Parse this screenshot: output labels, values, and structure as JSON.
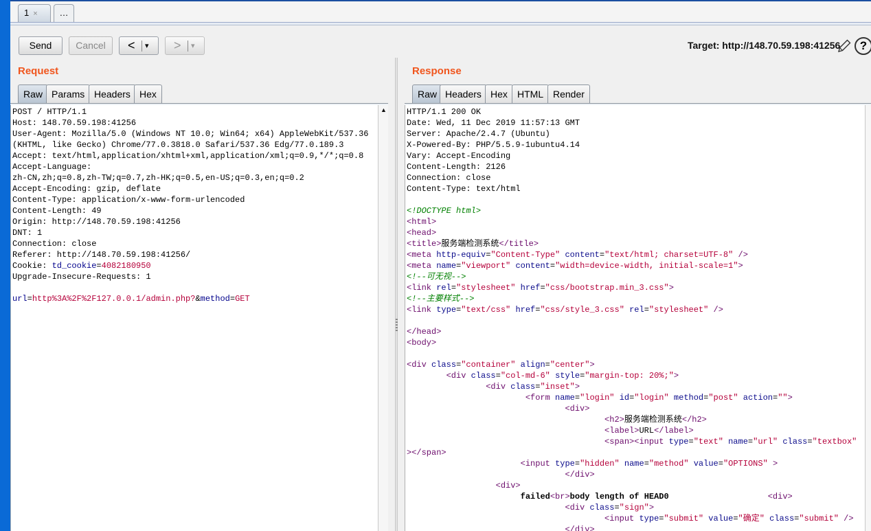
{
  "tabs": [
    {
      "label": "1",
      "close": "×"
    },
    {
      "label": "…"
    }
  ],
  "toolbar": {
    "send": "Send",
    "cancel": "Cancel",
    "back": "<",
    "forward": ">",
    "dropdown": "▾",
    "target_label": "Target: http://148.70.59.198:41256",
    "help": "?"
  },
  "request": {
    "title": "Request",
    "tabs": [
      "Raw",
      "Params",
      "Headers",
      "Hex"
    ],
    "lines": [
      "POST / HTTP/1.1",
      "Host: 148.70.59.198:41256",
      "User-Agent: Mozilla/5.0 (Windows NT 10.0; Win64; x64) AppleWebKit/537.36",
      "(KHTML, like Gecko) Chrome/77.0.3818.0 Safari/537.36 Edg/77.0.189.3",
      "Accept: text/html,application/xhtml+xml,application/xml;q=0.9,*/*;q=0.8",
      "Accept-Language:",
      "zh-CN,zh;q=0.8,zh-TW;q=0.7,zh-HK;q=0.5,en-US;q=0.3,en;q=0.2",
      "Accept-Encoding: gzip, deflate",
      "Content-Type: application/x-www-form-urlencoded",
      "Content-Length: 49",
      "Origin: http://148.70.59.198:41256",
      "DNT: 1",
      "Connection: close",
      "Referer: http://148.70.59.198:41256/"
    ],
    "cookie": {
      "prefix": "Cookie: ",
      "name": "td_cookie",
      "eq": "=",
      "value": "4082180950"
    },
    "upgrade": "Upgrade-Insecure-Requests: 1",
    "body": {
      "k1": "url",
      "v1": "http%3A%2F%2F127.0.0.1/admin.php?",
      "amp": "&",
      "k2": "method",
      "eq": "=",
      "v2": "GET"
    }
  },
  "response": {
    "title": "Response",
    "tabs": [
      "Raw",
      "Headers",
      "Hex",
      "HTML",
      "Render"
    ],
    "headers": [
      "HTTP/1.1 200 OK",
      "Date: Wed, 11 Dec 2019 11:57:13 GMT",
      "Server: Apache/2.4.7 (Ubuntu)",
      "X-Powered-By: PHP/5.5.9-1ubuntu4.14",
      "Vary: Accept-Encoding",
      "Content-Length: 2126",
      "Connection: close",
      "Content-Type: text/html"
    ],
    "doctype": "<!DOCTYPE html>",
    "title_text": "服务端检测系统",
    "comment1": "<!--可无视-->",
    "comment2": "<!--主要样式-->",
    "css1": "css/bootstrap.min_3.css",
    "css2": "css/style_3.css",
    "h2_text": "服务端检测系统",
    "label_text": "URL",
    "hidden_value": "OPTIONS",
    "failed_text": "failed",
    "body_length_text": "body length of HEAD0",
    "submit_value": "确定"
  }
}
